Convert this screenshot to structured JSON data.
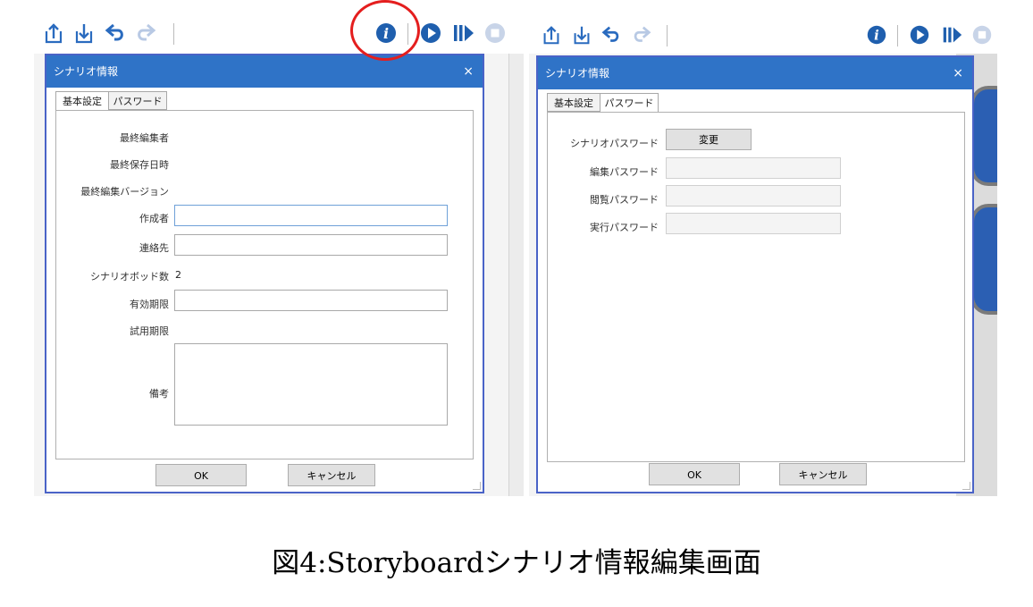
{
  "caption": "図4:Storyboardシナリオ情報編集画面",
  "toolbar": {
    "icons": [
      "upload-icon",
      "download-icon",
      "undo-icon",
      "redo-icon",
      "info-icon",
      "run-icon",
      "step-run-icon",
      "stop-icon"
    ],
    "accent_color": "#2f73c7",
    "highlight_color": "#e41e1e"
  },
  "left_dialog": {
    "title": "シナリオ情報",
    "close": "×",
    "tabs": [
      "基本設定",
      "パスワード"
    ],
    "active_tab": "基本設定",
    "fields": {
      "last_editor": "最終編集者",
      "last_saved": "最終保存日時",
      "last_version": "最終編集バージョン",
      "author": "作成者",
      "contact": "連絡先",
      "bot_count": "シナリオボッド数",
      "bot_count_value": "2",
      "expiry": "有効期限",
      "trial_expiry": "試用期限",
      "notes": "備考"
    },
    "ok": "OK",
    "cancel": "キャンセル"
  },
  "right_dialog": {
    "title": "シナリオ情報",
    "close": "×",
    "tabs": [
      "基本設定",
      "パスワード"
    ],
    "active_tab": "パスワード",
    "fields": {
      "scenario_password": "シナリオパスワード",
      "change": "変更",
      "edit_password": "編集パスワード",
      "view_password": "閲覧パスワード",
      "run_password": "実行パスワード"
    },
    "ok": "OK",
    "cancel": "キャンセル"
  }
}
